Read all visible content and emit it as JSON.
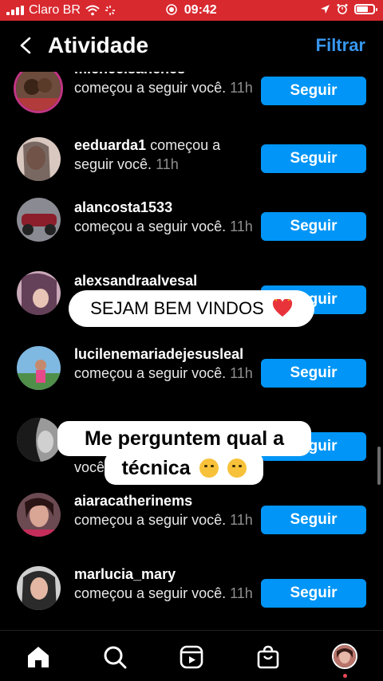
{
  "status_bar": {
    "carrier": "Claro BR",
    "time": "09:42"
  },
  "header": {
    "title": "Atividade",
    "filter_label": "Filtrar"
  },
  "activity": [
    {
      "username": "micheelsanches",
      "action": "começou a seguir você.",
      "time": "11h",
      "button": "Seguir"
    },
    {
      "username": "eeduarda1",
      "action": "começou a seguir você.",
      "time": "11h",
      "button": "Seguir"
    },
    {
      "username": "alancosta1533",
      "action": "começou a seguir você.",
      "time": "11h",
      "button": "Seguir"
    },
    {
      "username": "alexsandraalvesal",
      "action": "",
      "time": "",
      "button": "Seguir"
    },
    {
      "username": "lucilenemariadejesusleal",
      "action": "começou a seguir você.",
      "time": "11h",
      "button": "Seguir"
    },
    {
      "username": "",
      "action": "você.",
      "time": "",
      "button": "Seguir"
    },
    {
      "username": "aiaracatherinems",
      "action": "começou a seguir você.",
      "time": "11h",
      "button": "Seguir"
    },
    {
      "username": "marlucia_mary",
      "action": "começou a seguir você.",
      "time": "11h",
      "button": "Seguir"
    }
  ],
  "overlay": {
    "caption_1": "SEJAM BEM VINDOS",
    "caption_2_line1": "Me perguntem qual a",
    "caption_2_line2": "técnica"
  },
  "colors": {
    "status_bar": "#d8292f",
    "accent_blue": "#0095f6",
    "link_blue": "#3897f0"
  },
  "icons": [
    "back-chevron-icon",
    "home-icon",
    "search-icon",
    "reels-icon",
    "shop-icon",
    "heart-emoji-icon",
    "kissing-emoji-icon",
    "laughing-emoji-icon"
  ]
}
